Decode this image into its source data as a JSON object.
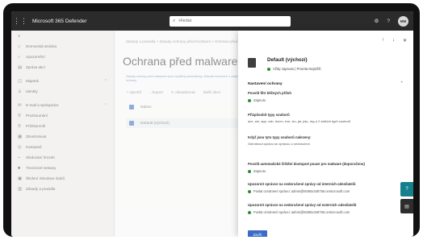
{
  "topbar": {
    "app_title": "Microsoft 365 Defender",
    "search_placeholder": "Hledat",
    "avatar_initials": "MM"
  },
  "leftnav": {
    "items": [
      {
        "label": "Domovská stránka",
        "icon": "home-icon"
      },
      {
        "label": "Upozornění",
        "icon": "bell-icon"
      },
      {
        "label": "Zpráva akcí",
        "icon": "clipboard-icon"
      },
      {
        "label": "Majetek",
        "icon": "asset-icon",
        "expandable": true
      },
      {
        "label": "Identity",
        "icon": "identity-icon"
      },
      {
        "label": "E-mail a spolupráce",
        "icon": "mail-icon",
        "expandable": true
      },
      {
        "label": "Prozkoumání",
        "icon": "investigate-icon"
      },
      {
        "label": "Průzkumník",
        "icon": "explorer-icon"
      },
      {
        "label": "Zkontrolovat",
        "icon": "review-icon"
      },
      {
        "label": "Kampaně",
        "icon": "campaign-icon"
      },
      {
        "label": "Sledování hrozeb",
        "icon": "tracker-icon"
      },
      {
        "label": "Trezorové sestavy",
        "icon": "vault-icon"
      },
      {
        "label": "Školení Simulace útoků",
        "icon": "training-icon"
      },
      {
        "label": "Zásady a pravidla",
        "icon": "policy-icon"
      }
    ]
  },
  "main": {
    "breadcrumb": "Zásady a pravidla  >  Zásady ochrany před hrozbami  >  Ochrana před malwarem",
    "title": "Ochrana před malwarem",
    "info": "Zásady ochrany před malwarem jsou spuštěny automaticky. Zobrazit informace o zásadách ochrany.",
    "toolbar": [
      "+ Vytvořit",
      "↓ Export",
      "↻ Aktualizovat",
      "Další akce"
    ],
    "list_header": "Název",
    "list_rows": [
      "Default (výchozí)"
    ]
  },
  "panel": {
    "controls": [
      "↑",
      "↓",
      "✕"
    ],
    "policy_name": "Default (výchozí)",
    "policy_status": "Vždy zapnuto | Priorita Nejnižší",
    "section_title": "Nastavení ochrany",
    "fields": [
      {
        "label": "Povolit filtr běžných příloh",
        "value": "Zapnuto",
        "dot": true
      },
      {
        "label": "Přizpůsobit typy souborů",
        "value": "ace, ani, app, cab, docm, exe, iso, jar, jnlp, reg a 2 dalších typů souborů",
        "dot": false
      },
      {
        "label": "Když jsou tyto typy souborů nalezeny:",
        "value": "Odmítnout zprávu se zprávou o nedoručení",
        "dot": false
      },
      {
        "label": "Povolit automatické čištění dostupné pouze pro malware (doporučeno)",
        "value": "Zapnuto",
        "dot": true
      },
      {
        "label": "Upozornit správce na nedoručené zprávy od interních odesílatelů",
        "value": "Poslat oznámení správci: admin@M365x348756.onmicrosoft.com",
        "dot": true
      },
      {
        "label": "Upozornit správce na nedoručené zprávy od externích odesílatelů",
        "value": "Poslat oznámení správci: admin@M365x348756.onmicrosoft.com",
        "dot": true
      }
    ],
    "close_label": "Zavřít"
  },
  "colors": {
    "topbar": "#2b2b2b",
    "accent": "#3a6bc6",
    "status_green": "#2f8f2f",
    "teal_fab": "#15808c"
  }
}
